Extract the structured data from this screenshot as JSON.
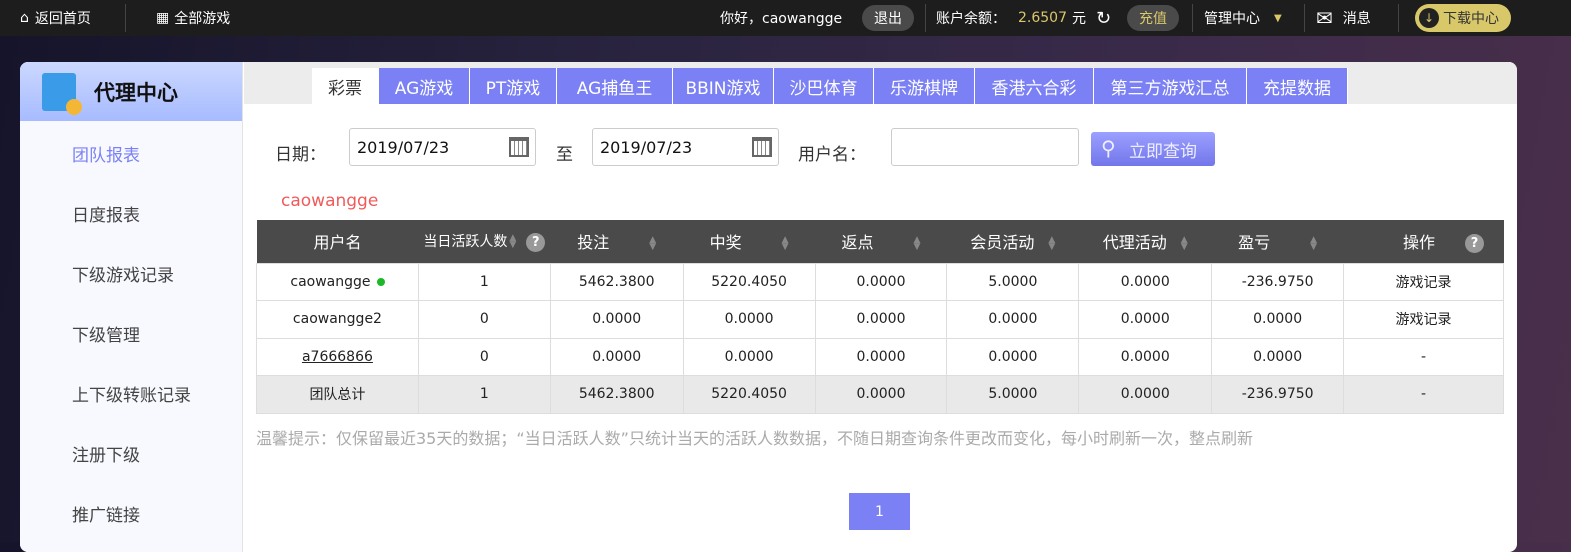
{
  "topbar": {
    "home": "返回首页",
    "all_games": "全部游戏",
    "greeting": "你好，caowangge",
    "logout": "退出",
    "balance_label": "账户余额：",
    "balance": "2.6507",
    "currency": "元",
    "recharge": "充值",
    "manage": "管理中心",
    "messages": "消息",
    "download": "下载中心"
  },
  "sidebar": {
    "title": "代理中心",
    "items": [
      "团队报表",
      "日度报表",
      "下级游戏记录",
      "下级管理",
      "上下级转账记录",
      "注册下级",
      "推广链接"
    ]
  },
  "tabs": [
    "彩票",
    "AG游戏",
    "PT游戏",
    "AG捕鱼王",
    "BBIN游戏",
    "沙巴体育",
    "乐游棋牌",
    "香港六合彩",
    "第三方游戏汇总",
    "充提数据"
  ],
  "form": {
    "date_label": "日期：",
    "start": "2019/07/23",
    "to": "至",
    "end": "2019/07/23",
    "user_label": "用户名：",
    "user_value": "",
    "search": "立即查询"
  },
  "current_user": "caowangge",
  "table": {
    "headers": [
      "用户名",
      "当日活跃人数",
      "投注",
      "中奖",
      "返点",
      "会员活动",
      "代理活动",
      "盈亏",
      "操作"
    ],
    "rows": [
      [
        "caowangge",
        "1",
        "5462.3800",
        "5220.4050",
        "0.0000",
        "5.0000",
        "0.0000",
        "-236.9750",
        "游戏记录"
      ],
      [
        "caowangge2",
        "0",
        "0.0000",
        "0.0000",
        "0.0000",
        "0.0000",
        "0.0000",
        "0.0000",
        "游戏记录"
      ],
      [
        "a7666866",
        "0",
        "0.0000",
        "0.0000",
        "0.0000",
        "0.0000",
        "0.0000",
        "0.0000",
        "-"
      ],
      [
        "团队总计",
        "1",
        "5462.3800",
        "5220.4050",
        "0.0000",
        "5.0000",
        "0.0000",
        "-236.9750",
        "-"
      ]
    ]
  },
  "hint": "温馨提示：仅保留最近35天的数据；“当日活跃人数”只统计当天的活跃人数数据，不随日期查询条件更改而变化，每小时刷新一次，整点刷新",
  "pagination": {
    "current": "1"
  }
}
